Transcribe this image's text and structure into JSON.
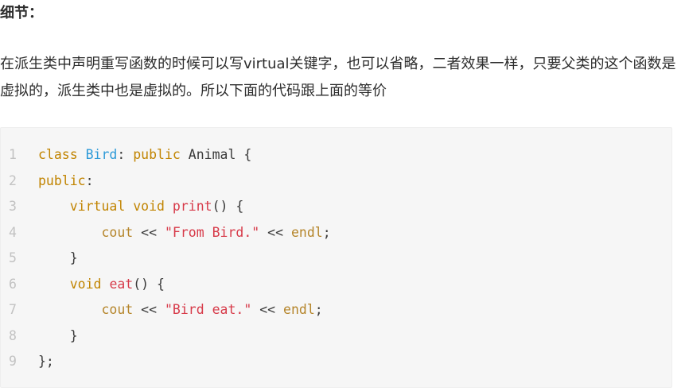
{
  "heading": "细节：",
  "paragraph": "在派生类中声明重写函数的时候可以写virtual关键字，也可以省略，二者效果一样，只要父类的这个函数是虚拟的，派生类中也是虚拟的。所以下面的代码跟上面的等价",
  "code": {
    "lines": [
      {
        "no": "1",
        "tokens": [
          {
            "t": "class",
            "k": "kw"
          },
          {
            "t": " ",
            "k": "plain"
          },
          {
            "t": "Bird",
            "k": "class"
          },
          {
            "t": ": ",
            "k": "plain"
          },
          {
            "t": "public",
            "k": "kw"
          },
          {
            "t": " Animal {",
            "k": "plain"
          }
        ]
      },
      {
        "no": "2",
        "tokens": [
          {
            "t": "public",
            "k": "kw"
          },
          {
            "t": ":",
            "k": "plain"
          }
        ]
      },
      {
        "no": "3",
        "tokens": [
          {
            "t": "    ",
            "k": "plain"
          },
          {
            "t": "virtual",
            "k": "kw"
          },
          {
            "t": " ",
            "k": "plain"
          },
          {
            "t": "void",
            "k": "kw"
          },
          {
            "t": " ",
            "k": "plain"
          },
          {
            "t": "print",
            "k": "fn"
          },
          {
            "t": "() {",
            "k": "plain"
          }
        ]
      },
      {
        "no": "4",
        "tokens": [
          {
            "t": "        ",
            "k": "plain"
          },
          {
            "t": "cout",
            "k": "ident"
          },
          {
            "t": " << ",
            "k": "plain"
          },
          {
            "t": "\"From Bird.\"",
            "k": "str"
          },
          {
            "t": " << ",
            "k": "plain"
          },
          {
            "t": "endl",
            "k": "ident"
          },
          {
            "t": ";",
            "k": "plain"
          }
        ]
      },
      {
        "no": "5",
        "tokens": [
          {
            "t": "    }",
            "k": "plain"
          }
        ]
      },
      {
        "no": "6",
        "tokens": [
          {
            "t": "    ",
            "k": "plain"
          },
          {
            "t": "void",
            "k": "kw"
          },
          {
            "t": " ",
            "k": "plain"
          },
          {
            "t": "eat",
            "k": "fn"
          },
          {
            "t": "() {",
            "k": "plain"
          }
        ]
      },
      {
        "no": "7",
        "tokens": [
          {
            "t": "        ",
            "k": "plain"
          },
          {
            "t": "cout",
            "k": "ident"
          },
          {
            "t": " << ",
            "k": "plain"
          },
          {
            "t": "\"Bird eat.\"",
            "k": "str"
          },
          {
            "t": " << ",
            "k": "plain"
          },
          {
            "t": "endl",
            "k": "ident"
          },
          {
            "t": ";",
            "k": "plain"
          }
        ]
      },
      {
        "no": "8",
        "tokens": [
          {
            "t": "    }",
            "k": "plain"
          }
        ]
      },
      {
        "no": "9",
        "tokens": [
          {
            "t": "};",
            "k": "plain"
          }
        ]
      }
    ]
  },
  "colors": {
    "keyword": "#c18401",
    "class_name": "#2d9ad8",
    "function": "#d73a49",
    "string": "#d73a49",
    "identifier": "#b5852a",
    "line_number": "#c2c2c2",
    "code_background": "#f6f6f6"
  }
}
